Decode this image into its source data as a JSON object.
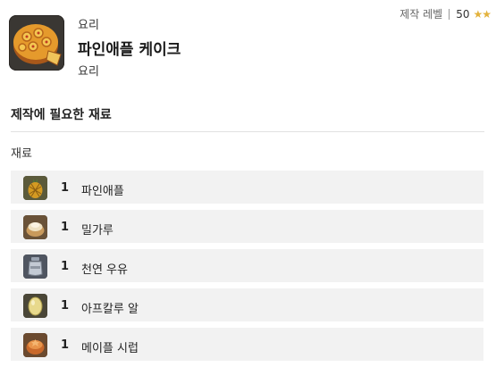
{
  "item": {
    "category_top": "요리",
    "name": "파인애플 케이크",
    "category_bottom": "요리",
    "icon": "pineapple-cake-icon"
  },
  "crafting_level": {
    "label": "제작 레벨",
    "value": "50",
    "stars": "★★",
    "star_color": "#e3b23c"
  },
  "section_title": "제작에 필요한 재료",
  "group_label": "재료",
  "materials": [
    {
      "qty": "1",
      "name": "파인애플",
      "icon": "pineapple-icon"
    },
    {
      "qty": "1",
      "name": "밀가루",
      "icon": "flour-icon"
    },
    {
      "qty": "1",
      "name": "천연 우유",
      "icon": "milk-jar-icon"
    },
    {
      "qty": "1",
      "name": "아프칼루 알",
      "icon": "egg-icon"
    },
    {
      "qty": "1",
      "name": "메이플 시럽",
      "icon": "maple-syrup-icon"
    }
  ]
}
